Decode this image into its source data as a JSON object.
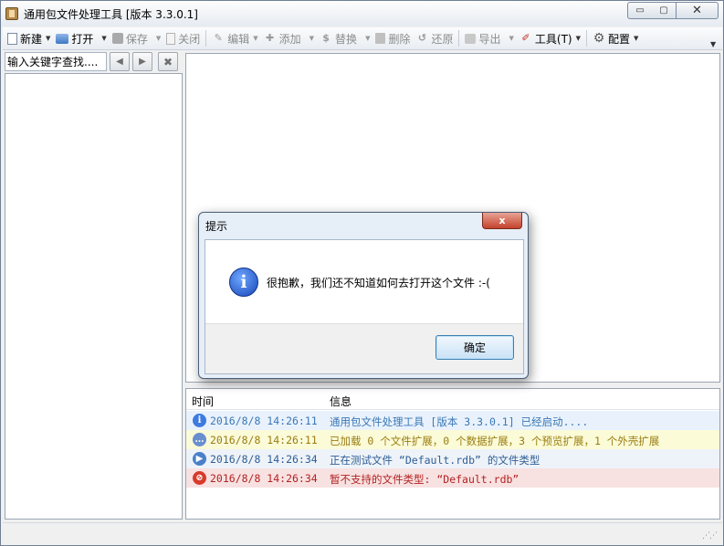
{
  "window": {
    "title": "通用包文件处理工具 [版本 3.3.0.1]",
    "minimize_glyph": "▭",
    "maximize_glyph": "▢",
    "close_glyph": "✕"
  },
  "toolbar": {
    "new_label": "新建",
    "open_label": "打开",
    "save_label": "保存",
    "close_label": "关闭",
    "edit_label": "编辑",
    "add_label": "添加",
    "replace_label": "替换",
    "delete_label": "删除",
    "restore_label": "还原",
    "export_label": "导出",
    "tools_label": "工具(T)",
    "config_label": "配置"
  },
  "left_panel": {
    "search_placeholder": "输入关键字查找....",
    "prev_glyph": "◀",
    "next_glyph": "▶",
    "clear_glyph": "✖"
  },
  "log": {
    "headers": {
      "time": "时间",
      "info": "信息"
    },
    "rows": [
      {
        "icon": "info-icon",
        "glyph": "i",
        "time": "2016/8/8 14:26:11",
        "message": "通用包文件处理工具 [版本 3.3.0.1] 已经启动....",
        "bg": "#e9f2fc",
        "color": "#3b78b5",
        "icon_color": "#3d7be0"
      },
      {
        "icon": "message-icon",
        "glyph": "…",
        "time": "2016/8/8 14:26:11",
        "message": "已加载 0 个文件扩展，0 个数据扩展，3 个预览扩展，1 个外壳扩展",
        "bg": "#fbfbd8",
        "color": "#9a7d12",
        "icon_color": "#6a8fcf"
      },
      {
        "icon": "play-icon",
        "glyph": "▶",
        "time": "2016/8/8 14:26:34",
        "message": "正在测试文件 “Default.rdb” 的文件类型",
        "bg": "#eef3f9",
        "color": "#2f5e94",
        "icon_color": "#4a80c8"
      },
      {
        "icon": "error-icon",
        "glyph": "⊘",
        "time": "2016/8/8 14:26:34",
        "message": "暂不支持的文件类型: “Default.rdb”",
        "bg": "#f8e1e1",
        "color": "#b22222",
        "icon_color": "#d83a2a"
      }
    ]
  },
  "dialog": {
    "title": "提示",
    "message": "很抱歉，我们还不知道如何去打开这个文件 :-(",
    "ok_label": "确定",
    "close_glyph": "x",
    "info_glyph": "i"
  }
}
